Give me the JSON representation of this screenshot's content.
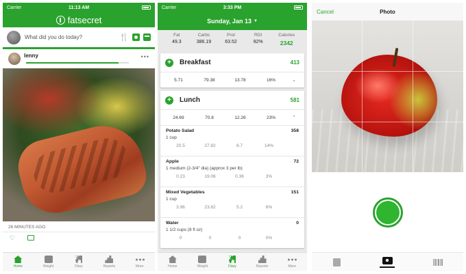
{
  "phone1": {
    "status": {
      "carrier": "Carrier",
      "time": "11:13 AM"
    },
    "app_title": "fatsecret",
    "post_placeholder": "What did you do today?",
    "feed": {
      "username": "lenny",
      "time_ago": "26 MINUTES AGO",
      "progress": 0.9
    },
    "tabs": [
      {
        "label": "Home",
        "icon": "home-icon"
      },
      {
        "label": "Weight",
        "icon": "weight-icon"
      },
      {
        "label": "Diary",
        "icon": "diary-icon"
      },
      {
        "label": "Reports",
        "icon": "reports-icon"
      },
      {
        "label": "More",
        "icon": "more-icon"
      }
    ],
    "active_tab": "Home"
  },
  "phone2": {
    "status": {
      "carrier": "Carrier",
      "time": "3:33 PM"
    },
    "date": "Sunday, Jan 13",
    "summary": {
      "headers": [
        "Fat",
        "Carbs",
        "Prot",
        "RDI",
        "Calories"
      ],
      "values": [
        "49.3",
        "386.19",
        "63.52",
        "92%",
        "2342"
      ]
    },
    "breakfast": {
      "name": "Breakfast",
      "calories": "413",
      "totals": [
        "5.71",
        "79.38",
        "13.78",
        "16%"
      ]
    },
    "lunch": {
      "name": "Lunch",
      "calories": "581",
      "totals": [
        "24.69",
        "70.8",
        "12.26",
        "23%"
      ],
      "items": [
        {
          "name": "Potato Salad",
          "calories": "358",
          "serving": "1 cup",
          "nums": [
            "20.5",
            "27.92",
            "6.7",
            "14%"
          ]
        },
        {
          "name": "Apple",
          "calories": "72",
          "serving": "1 medium (2-3/4\" dia) (approx 3 per lb)",
          "nums": [
            "0.23",
            "19.06",
            "0.36",
            "3%"
          ]
        },
        {
          "name": "Mixed Vegetables",
          "calories": "151",
          "serving": "1 cup",
          "nums": [
            "3.96",
            "23.82",
            "5.2",
            "6%"
          ]
        },
        {
          "name": "Water",
          "calories": "0",
          "serving": "1 1/2 cups (8 fl oz)",
          "nums": [
            "0",
            "0",
            "0",
            "0%"
          ]
        }
      ]
    },
    "tabs": [
      "Home",
      "Weight",
      "Diary",
      "Reports",
      "More"
    ],
    "active_tab": "Diary"
  },
  "phone3": {
    "cancel_label": "Cancel",
    "title": "Photo",
    "tabs": [
      {
        "icon": "gallery-icon"
      },
      {
        "icon": "camera-icon"
      },
      {
        "icon": "barcode-icon"
      }
    ],
    "active_tab": "camera-icon"
  },
  "colors": {
    "brand": "#2aa22e",
    "bg_gray": "#e9e9e9"
  }
}
